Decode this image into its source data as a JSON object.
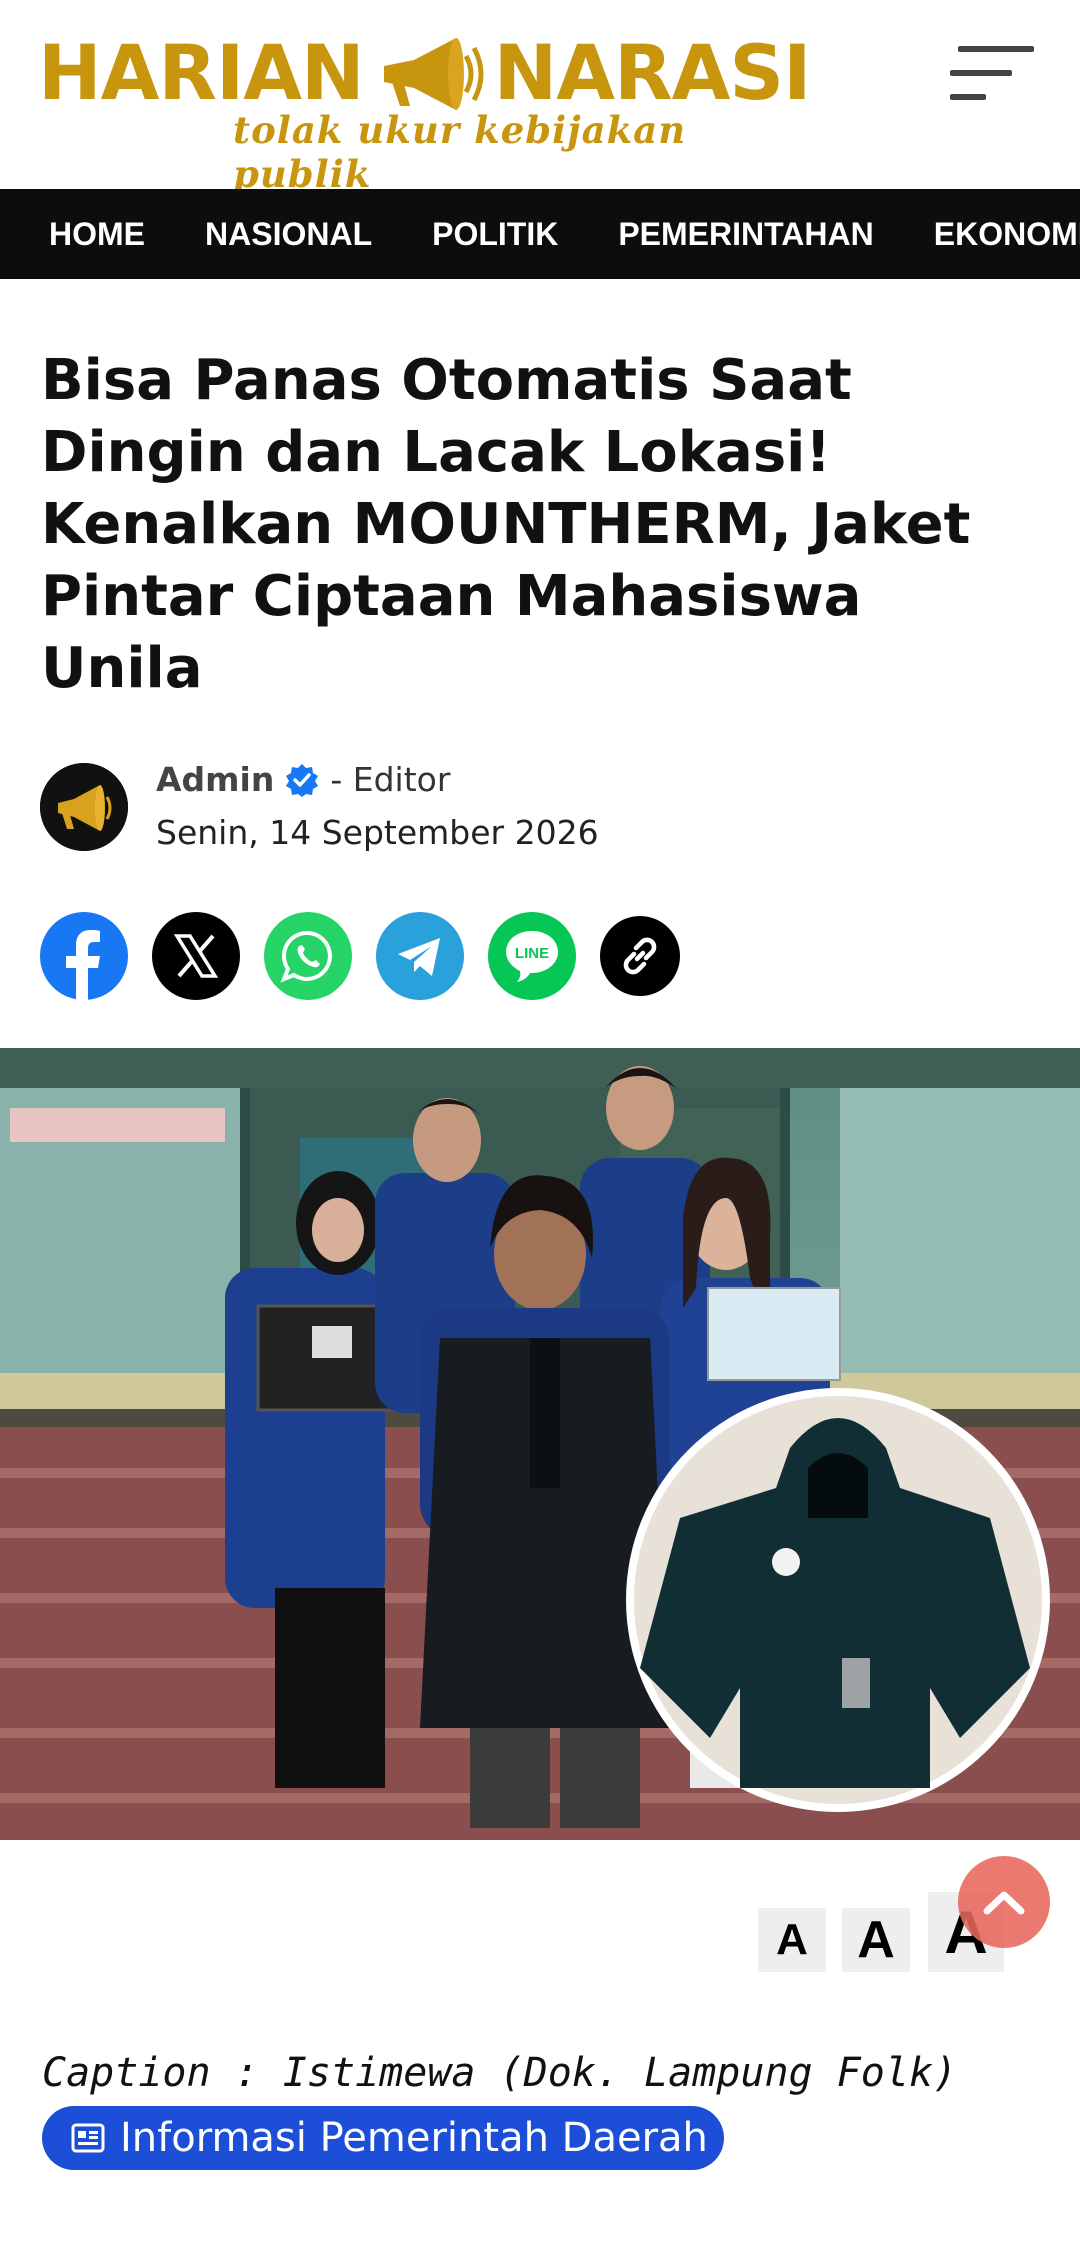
{
  "header": {
    "logo_left": "HARIAN",
    "logo_right": "NARASI",
    "tagline": "tolak ukur kebijakan publik",
    "brand_color": "#c8950f",
    "menu_icon": "hamburger-icon"
  },
  "nav": {
    "items": [
      "HOME",
      "NASIONAL",
      "POLITIK",
      "PEMERINTAHAN",
      "EKONOMI"
    ]
  },
  "article": {
    "title": "Bisa Panas Otomatis Saat Dingin dan Lacak Lokasi! Kenalkan MOUNTHERM, Jaket Pintar Ciptaan Mahasiswa Unila",
    "author": "Admin",
    "role": "- Editor",
    "date": "Senin, 14 September 2026",
    "caption": "Caption : Istimewa (Dok. Lampung Folk)",
    "info_button": "Informasi Pemerintah Daerah"
  },
  "share": [
    {
      "name": "facebook",
      "color": "#1877f2"
    },
    {
      "name": "x",
      "color": "#000000"
    },
    {
      "name": "whatsapp",
      "color": "#25d366"
    },
    {
      "name": "telegram",
      "color": "#2aa1da"
    },
    {
      "name": "line",
      "color": "#06c755"
    },
    {
      "name": "copy-link",
      "color": "#000000"
    }
  ],
  "font_size_buttons": [
    "A",
    "A",
    "A"
  ],
  "colors": {
    "nav_bg": "#0d0d0d",
    "info_button_bg": "#1d4ed8",
    "scroll_top_bg": "#e8685c"
  }
}
